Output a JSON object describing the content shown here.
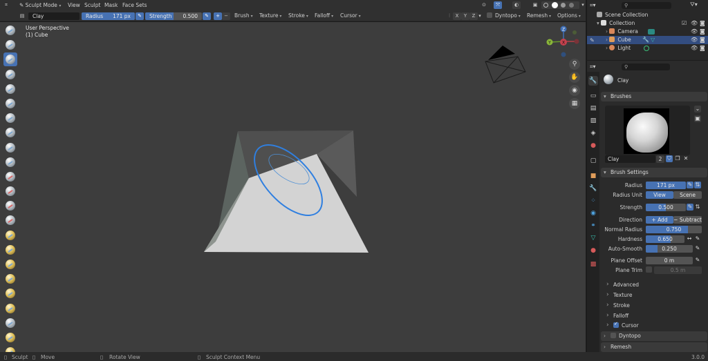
{
  "header": {
    "mode": "Sculpt Mode",
    "menus": [
      "View",
      "Sculpt",
      "Mask",
      "Face Sets"
    ],
    "axes": [
      "X",
      "Y",
      "Z"
    ],
    "dyntopo": "Dyntopo",
    "remesh": "Remesh",
    "options": "Options"
  },
  "toolsettings": {
    "brush_name": "Clay",
    "radius_label": "Radius",
    "radius_value": "171 px",
    "strength_label": "Strength",
    "strength_value": "0.500",
    "strength_fraction": 0.5,
    "add_symbol": "+",
    "sub_symbol": "−",
    "menus": [
      "Brush",
      "Texture",
      "Stroke",
      "Falloff",
      "Cursor"
    ]
  },
  "viewport": {
    "perspective": "User Perspective",
    "object": "(1) Cube"
  },
  "outliner": {
    "scene_collection": "Scene Collection",
    "collection": "Collection",
    "objects": [
      "Camera",
      "Cube",
      "Light"
    ]
  },
  "properties": {
    "brush_title": "Clay",
    "brushes_panel": "Brushes",
    "brush_field": "Clay",
    "user_count": "2",
    "brush_settings_panel": "Brush Settings",
    "radius_label": "Radius",
    "radius_value": "171 px",
    "radius_unit_label": "Radius Unit",
    "unit_view": "View",
    "unit_scene": "Scene",
    "strength_label": "Strength",
    "strength_value": "0.500",
    "strength_fraction": 0.5,
    "direction_label": "Direction",
    "dir_add": "Add",
    "dir_subtract": "Subtract",
    "normal_radius_label": "Normal Radius",
    "normal_radius_value": "0.750",
    "normal_radius_fraction": 0.75,
    "hardness_label": "Hardness",
    "hardness_value": "0.650",
    "hardness_fraction": 0.65,
    "autosmooth_label": "Auto-Smooth",
    "autosmooth_value": "0.250",
    "autosmooth_fraction": 0.25,
    "plane_offset_label": "Plane Offset",
    "plane_offset_value": "0 m",
    "plane_trim_label": "Plane Trim",
    "plane_trim_value": "0.5 m",
    "subpanels": [
      "Advanced",
      "Texture",
      "Stroke",
      "Falloff",
      "Cursor"
    ],
    "dyntopo_panel": "Dyntopo",
    "remesh_panel": "Remesh"
  },
  "status": {
    "sculpt": "Sculpt",
    "move": "Move",
    "rotate": "Rotate View",
    "context": "Sculpt Context Menu",
    "version": "3.0.0"
  },
  "colors": {
    "accent": "#4772b3",
    "selection": "#334d80",
    "brush_ring": "#2f7fe0"
  }
}
